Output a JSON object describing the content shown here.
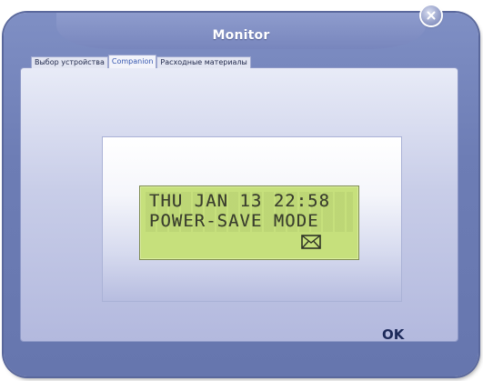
{
  "window": {
    "title": "Monitor"
  },
  "tabs": [
    {
      "label": "Выбор устройства",
      "active": false
    },
    {
      "label": "Companion",
      "active": true
    },
    {
      "label": "Расходные материалы",
      "active": false
    }
  ],
  "lcd": {
    "line1": "THU JAN 13 22:58",
    "line2": "POWER-SAVE MODE",
    "backlight_color": "#c6e07c",
    "icon": "envelope-icon"
  },
  "buttons": {
    "ok_label": "OK"
  },
  "colors": {
    "frame": "#6d7db5",
    "active_tab_text": "#3657b0"
  }
}
